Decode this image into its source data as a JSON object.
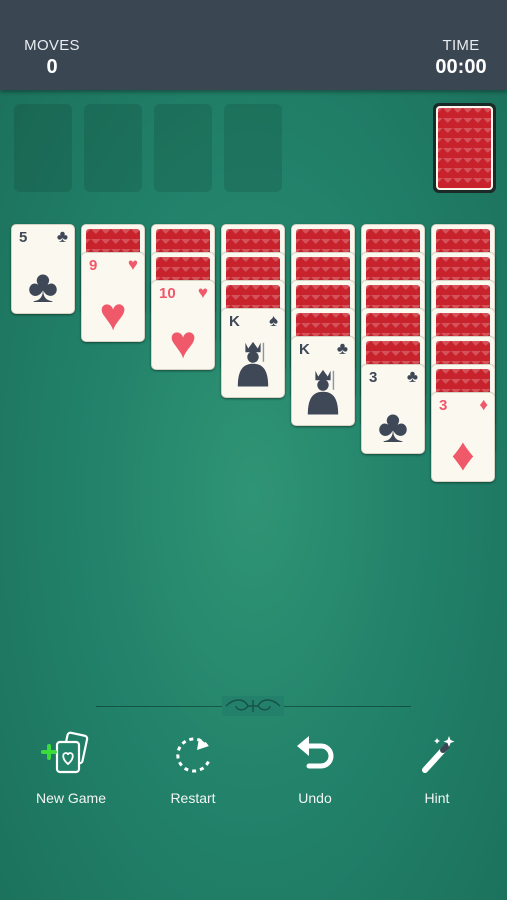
{
  "header": {
    "moves_label": "MOVES",
    "moves_value": "0",
    "time_label": "TIME",
    "time_value": "00:00"
  },
  "foundations": [
    {
      "name": "foundation-1"
    },
    {
      "name": "foundation-2"
    },
    {
      "name": "foundation-3"
    },
    {
      "name": "foundation-4"
    }
  ],
  "stock": {
    "face": "down"
  },
  "tableau": [
    {
      "face_down": 0,
      "top_card": {
        "rank": "5",
        "suit": "♣",
        "color": "black"
      }
    },
    {
      "face_down": 1,
      "top_card": {
        "rank": "9",
        "suit": "♥",
        "color": "red"
      }
    },
    {
      "face_down": 2,
      "top_card": {
        "rank": "10",
        "suit": "♥",
        "color": "red"
      }
    },
    {
      "face_down": 3,
      "top_card": {
        "rank": "K",
        "suit": "♠",
        "color": "black"
      }
    },
    {
      "face_down": 4,
      "top_card": {
        "rank": "K",
        "suit": "♣",
        "color": "black"
      }
    },
    {
      "face_down": 5,
      "top_card": {
        "rank": "3",
        "suit": "♣",
        "color": "black"
      }
    },
    {
      "face_down": 6,
      "top_card": {
        "rank": "3",
        "suit": "♦",
        "color": "red"
      }
    }
  ],
  "toolbar": {
    "new_game": "New Game",
    "restart": "Restart",
    "undo": "Undo",
    "hint": "Hint"
  },
  "colors": {
    "felt": "#22826a",
    "header": "#3b4653",
    "card_back": "#c8222c",
    "red_suit": "#f0596a",
    "black_suit": "#3f4857",
    "new_game_plus": "#3ddc3d"
  }
}
